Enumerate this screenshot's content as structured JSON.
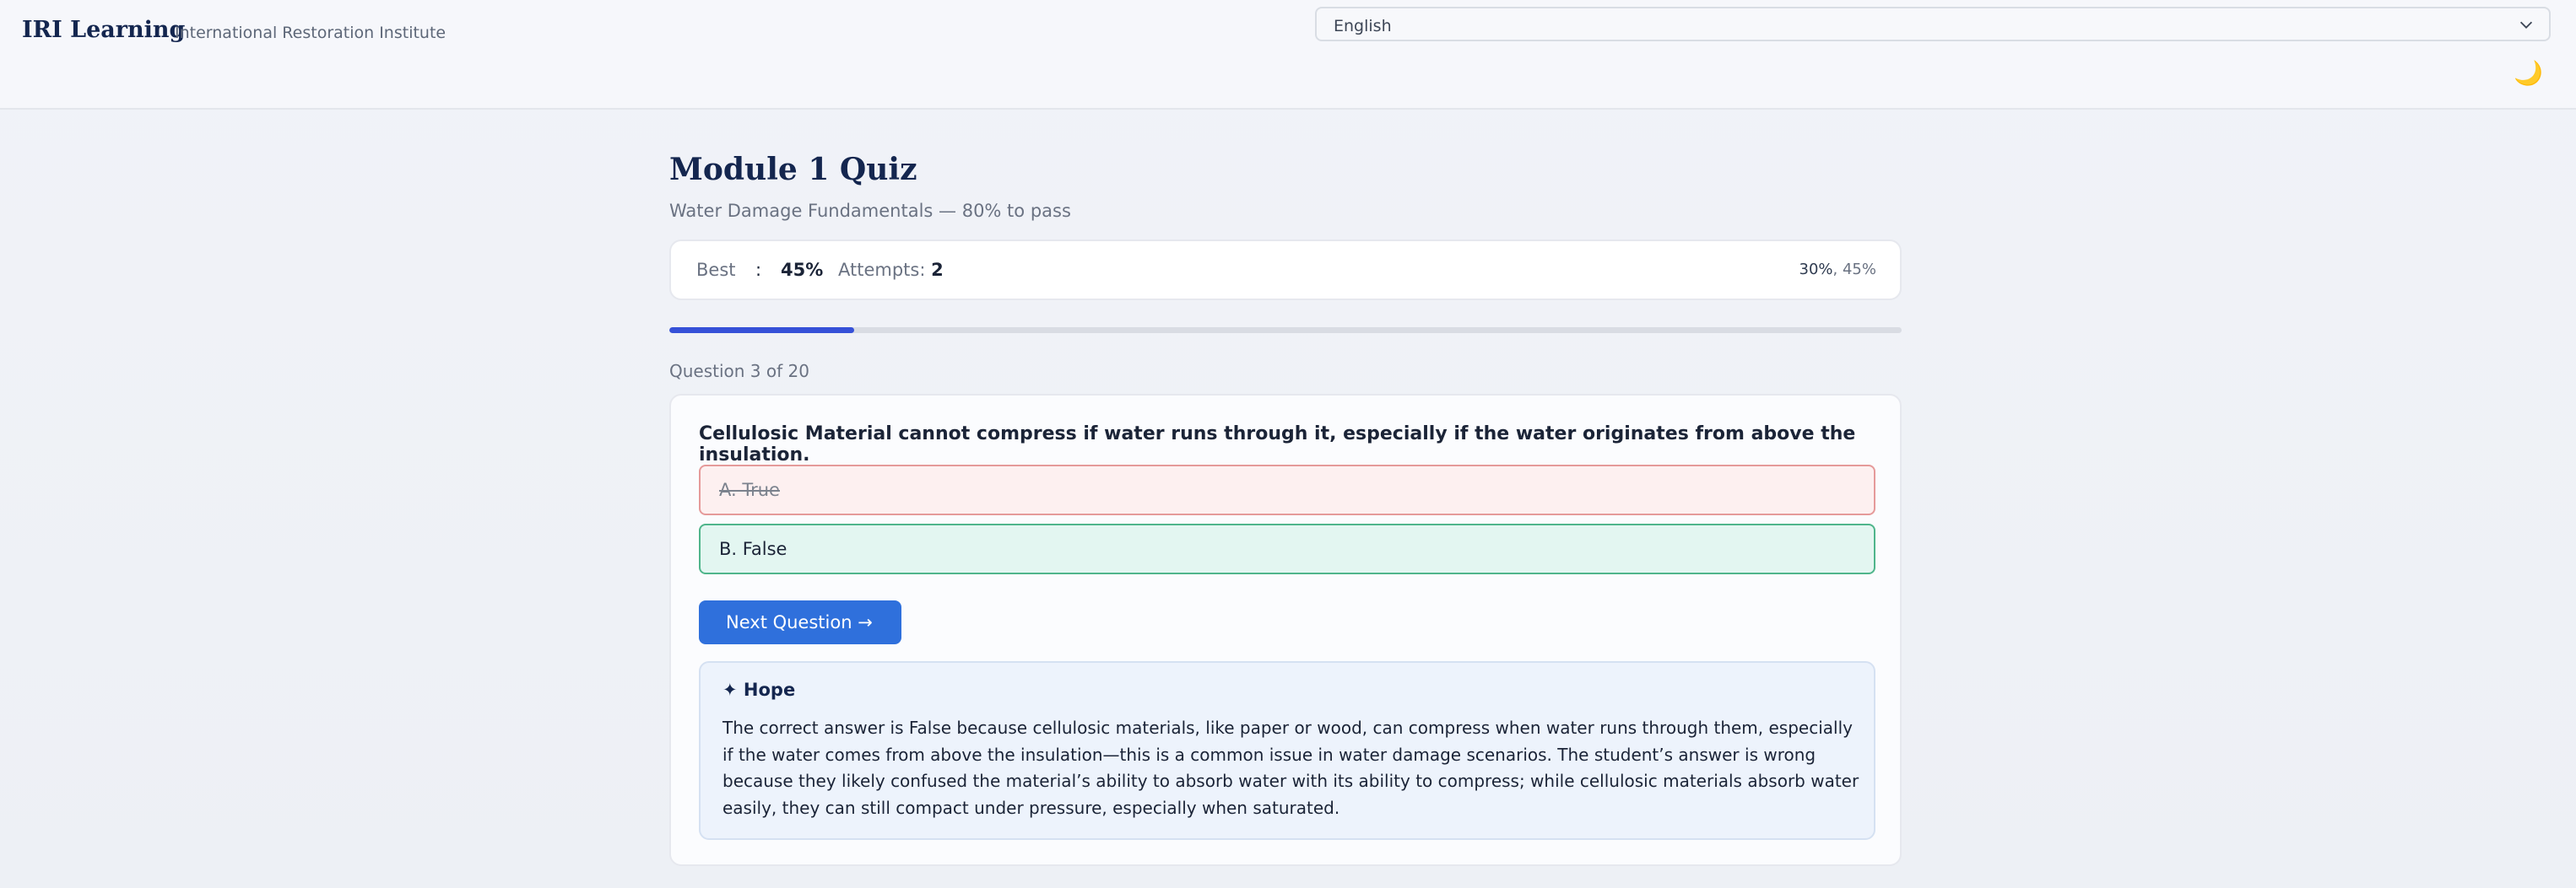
{
  "header": {
    "brand": "IRI Learning",
    "brand_subtitle": "International Restoration Institute",
    "language": "English",
    "theme_icon": "moon-icon"
  },
  "quiz": {
    "title": "Module 1 Quiz",
    "subtitle": "Water Damage Fundamentals — 80% to pass",
    "stats": {
      "best_label": "Best",
      "colon": ":",
      "best_value": "45%",
      "attempts_label": "Attempts:",
      "attempts_value": "2",
      "history": [
        "30%",
        "45%"
      ],
      "history_separator": ","
    },
    "progress_fraction": 0.15,
    "question_counter": "Question 3 of 20",
    "question_text": "Cellulosic Material cannot compress if water runs through it, especially if the water originates from above the insulation.",
    "options": [
      {
        "label": "A. True",
        "state": "incorrect"
      },
      {
        "label": "B. False",
        "state": "correct"
      }
    ],
    "next_button": "Next Question →",
    "feedback": {
      "title": "✦ Hope",
      "body": "The correct answer is False because cellulosic materials, like paper or wood, can compress when water runs through them, especially if the water comes from above the insulation—this is a common issue in water damage scenarios. The student’s answer is wrong because they likely confused the material’s ability to absorb water with its ability to compress; while cellulosic materials absorb water easily, they can still compact under pressure, especially when saturated."
    }
  },
  "colors": {
    "accent": "#2f70dc",
    "progress": "#3651d8",
    "incorrect_border": "#e59a9a",
    "correct_border": "#4fb58b",
    "brand": "#14264f"
  }
}
